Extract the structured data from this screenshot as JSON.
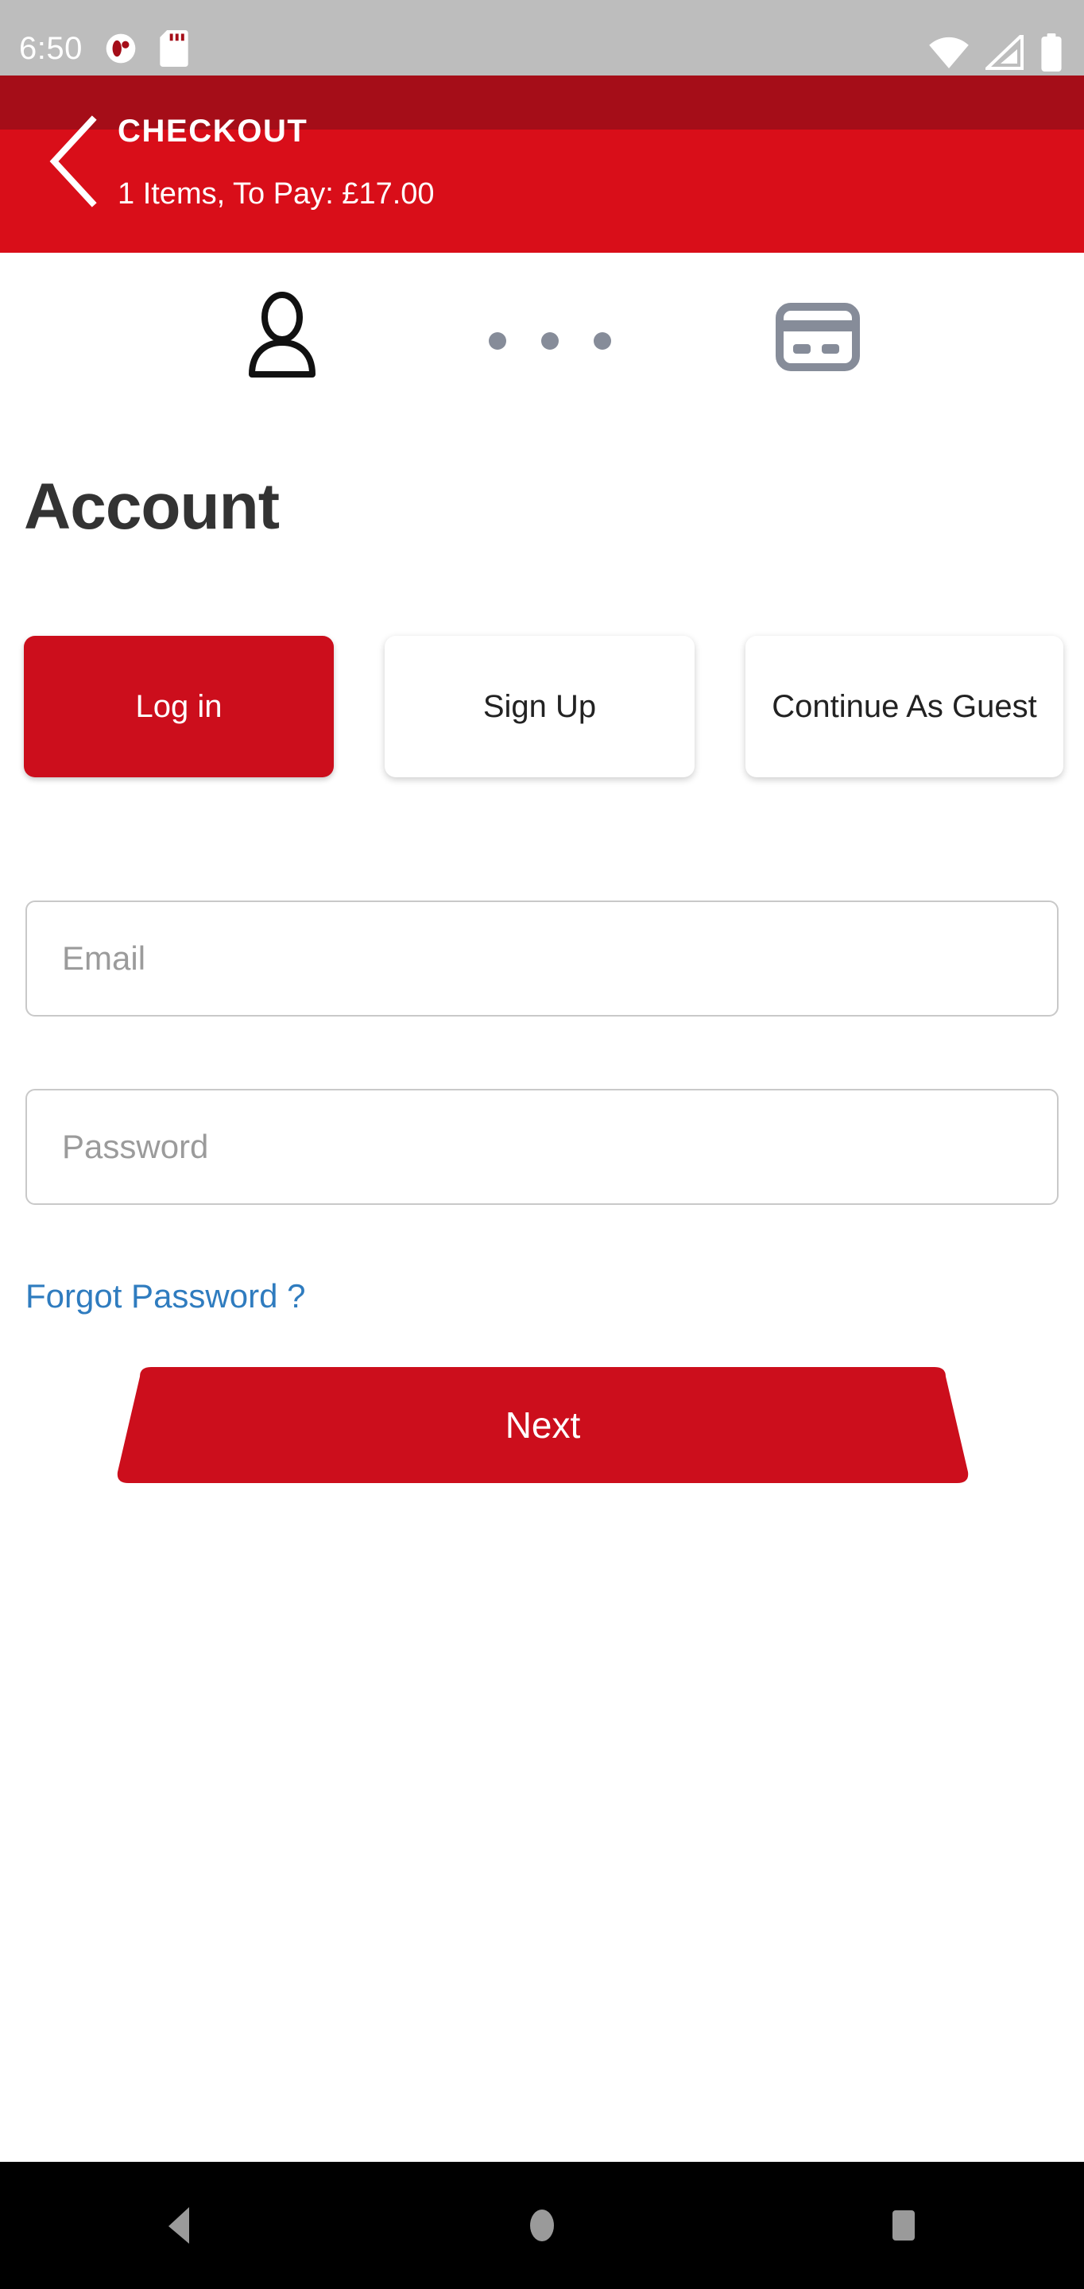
{
  "status_bar": {
    "time": "6:50",
    "icons_left": [
      "notification-icon",
      "sd-card-icon"
    ],
    "icons_right": [
      "wifi-icon",
      "cellular-signal-icon",
      "battery-icon"
    ],
    "background_top": "#bdbdbd",
    "background_band": "#a50d18"
  },
  "header": {
    "back_label": "back-chevron",
    "title": "CHECKOUT",
    "subtitle": "1 Items, To Pay: £17.00",
    "background": "#d90e19"
  },
  "stepper": {
    "steps": [
      {
        "name": "account-step",
        "icon": "user-icon",
        "active": true,
        "color": "#111111"
      },
      {
        "name": "payment-step",
        "icon": "credit-card-icon",
        "active": false,
        "color": "#868c99"
      }
    ],
    "separator_dots": 3,
    "dot_color": "#868c99"
  },
  "main": {
    "page_title": "Account",
    "tabs": [
      {
        "label": "Log in",
        "active": true
      },
      {
        "label": "Sign Up",
        "active": false
      },
      {
        "label": "Continue As Guest",
        "active": false
      }
    ],
    "active_tab_color": "#cc0e1c",
    "fields": [
      {
        "name": "email",
        "value": "",
        "placeholder": "Email"
      },
      {
        "name": "password",
        "value": "",
        "placeholder": "Password"
      }
    ],
    "forgot_password_label": "Forgot Password ?",
    "forgot_password_color": "#2f7cbf",
    "submit_label": "Next",
    "submit_color": "#cc0e1c"
  },
  "nav_bar": {
    "buttons": [
      {
        "name": "back-nav-button",
        "icon": "triangle-back-icon"
      },
      {
        "name": "home-nav-button",
        "icon": "circle-home-icon"
      },
      {
        "name": "recents-nav-button",
        "icon": "square-recents-icon"
      }
    ],
    "icon_color": "#9a9a9a",
    "background": "#000000"
  }
}
